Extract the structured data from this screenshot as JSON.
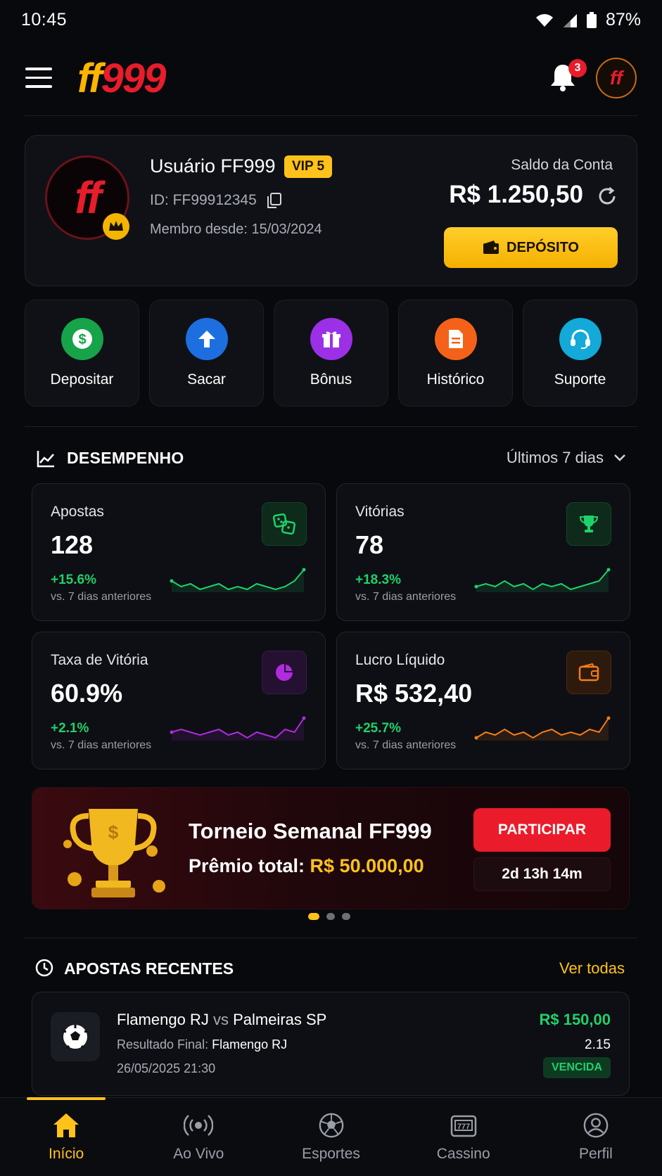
{
  "status_bar": {
    "time": "10:45",
    "battery": "87%"
  },
  "header": {
    "logo_ff": "ff",
    "logo_num": "999",
    "notifications_count": "3",
    "avatar_text": "ff"
  },
  "profile": {
    "avatar_text": "ff",
    "username": "Usuário FF999",
    "vip": "VIP 5",
    "id": "ID: FF99912345",
    "member_since": "Membro desde: 15/03/2024",
    "balance_label": "Saldo da Conta",
    "balance": "R$ 1.250,50",
    "deposit_button": "DEPÓSITO"
  },
  "quick_actions": [
    {
      "label": "Depositar",
      "icon": "dollar-icon",
      "color": "#16a34a"
    },
    {
      "label": "Sacar",
      "icon": "arrow-up-icon",
      "color": "#1d6fe0"
    },
    {
      "label": "Bônus",
      "icon": "gift-icon",
      "color": "#9b30e6"
    },
    {
      "label": "Histórico",
      "icon": "document-icon",
      "color": "#f4621a"
    },
    {
      "label": "Suporte",
      "icon": "headset-icon",
      "color": "#13a9d8"
    }
  ],
  "performance": {
    "title": "DESEMPENHO",
    "range": "Últimos 7 dias",
    "stats": [
      {
        "name": "Apostas",
        "value": "128",
        "change": "+15.6%",
        "compare": "vs. 7 dias anteriores",
        "icon": "dice-icon",
        "color": "#1fd16a",
        "trend": [
          5,
          3,
          4,
          2,
          3,
          4,
          2,
          3,
          2,
          4,
          3,
          2,
          3,
          5,
          9
        ]
      },
      {
        "name": "Vitórias",
        "value": "78",
        "change": "+18.3%",
        "compare": "vs. 7 dias anteriores",
        "icon": "trophy-icon",
        "color": "#1fd16a",
        "trend": [
          3,
          4,
          3,
          5,
          3,
          4,
          2,
          4,
          3,
          4,
          2,
          3,
          4,
          5,
          9
        ]
      },
      {
        "name": "Taxa de Vitória",
        "value": "60.9%",
        "change": "+2.1%",
        "compare": "vs. 7 dias anteriores",
        "icon": "pie-chart-icon",
        "color": "#b02be0",
        "trend": [
          4,
          5,
          4,
          3,
          4,
          5,
          3,
          4,
          2,
          4,
          3,
          2,
          5,
          4,
          9
        ]
      },
      {
        "name": "Lucro Líquido",
        "value": "R$ 532,40",
        "change": "+25.7%",
        "compare": "vs. 7 dias anteriores",
        "icon": "wallet-icon",
        "color": "#f57c1a",
        "trend": [
          2,
          4,
          3,
          5,
          3,
          4,
          2,
          4,
          5,
          3,
          4,
          3,
          5,
          4,
          9
        ]
      }
    ]
  },
  "promo": {
    "title": "Torneio Semanal FF999",
    "prize_label": "Prêmio total: ",
    "prize_amount": "R$ 50.000,00",
    "join_button": "PARTICIPAR",
    "timer": "2d 13h 14m"
  },
  "recent_bets": {
    "title": "APOSTAS RECENTES",
    "see_all": "Ver todas",
    "items": [
      {
        "team_a": "Flamengo RJ",
        "vs": " vs ",
        "team_b": "Palmeiras SP",
        "result_label": "Resultado Final: ",
        "result_value": "Flamengo RJ",
        "date": "26/05/2025 21:30",
        "amount": "R$ 150,00",
        "odd": "2.15",
        "status": "VENCIDA"
      }
    ]
  },
  "bottom_nav": [
    {
      "label": "Início",
      "icon": "home-icon",
      "active": true
    },
    {
      "label": "Ao Vivo",
      "icon": "live-broadcast-icon",
      "active": false
    },
    {
      "label": "Esportes",
      "icon": "soccer-ball-icon",
      "active": false
    },
    {
      "label": "Cassino",
      "icon": "slot-machine-icon",
      "active": false
    },
    {
      "label": "Perfil",
      "icon": "user-icon",
      "active": false
    }
  ]
}
